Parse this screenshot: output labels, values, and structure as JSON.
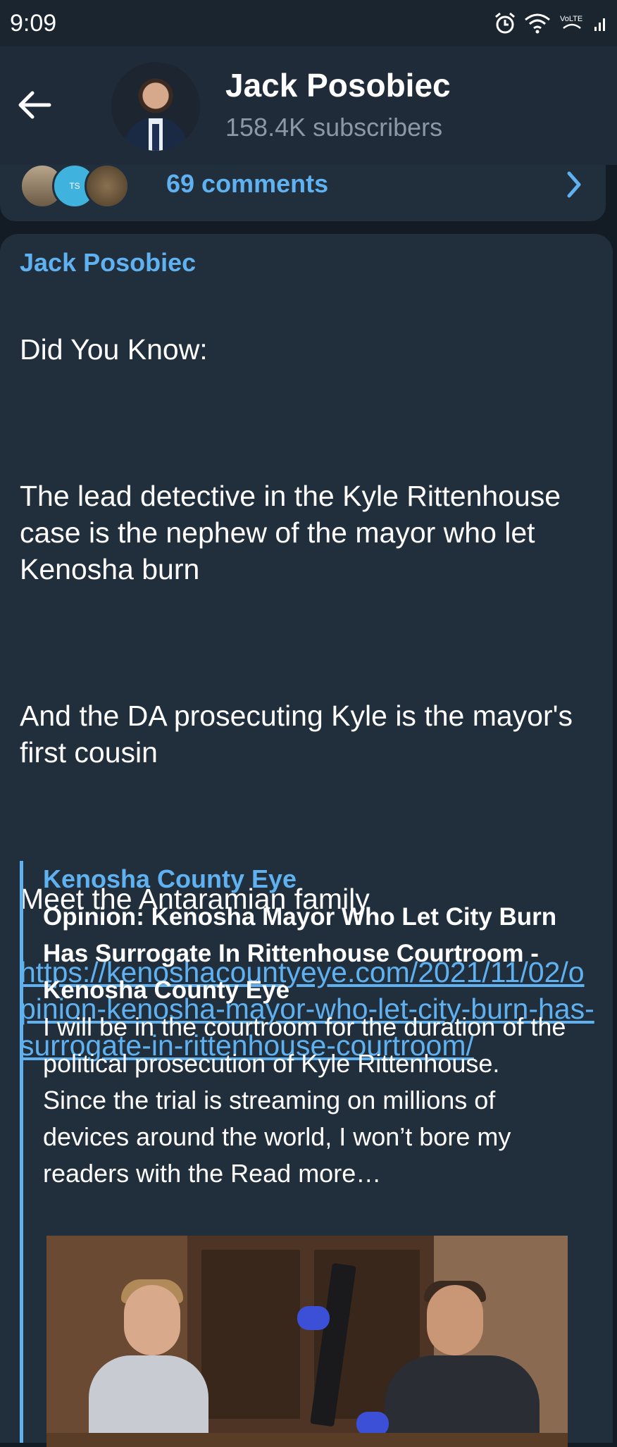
{
  "status_bar": {
    "time": "9:09",
    "icons": [
      "alarm-icon",
      "wifi-icon",
      "volte-icon",
      "signal-icon"
    ],
    "volte_label": "VoLTE"
  },
  "header": {
    "channel_name": "Jack Posobiec",
    "subscribers": "158.4K subscribers"
  },
  "previous_post": {
    "comments_label": "69 comments",
    "commenter_initials": "TS"
  },
  "message": {
    "author": "Jack Posobiec",
    "line1": "Did You Know:",
    "para2": "The lead detective in the Kyle Rittenhouse case is the nephew of the mayor who let Kenosha burn",
    "para3": "And the DA prosecuting Kyle is the mayor's first cousin",
    "para4": "Meet the Antaramian family",
    "link": "https://kenoshacountyeye.com/2021/11/02/opinion-kenosha-mayor-who-let-city-burn-has-surrogate-in-rittenhouse-courtroom/"
  },
  "link_preview": {
    "site_name": "Kenosha County Eye",
    "title": "Opinion: Kenosha Mayor Who Let City Burn Has Surrogate In Rittenhouse Courtroom - Kenosha County Eye",
    "description": "I will be in the courtroom for the duration of the political prosecution of Kyle Rittenhouse. Since the trial is streaming on millions of devices around the world, I won’t bore my readers with the Read more…"
  },
  "colors": {
    "accent": "#5fb1f0",
    "background": "#131b24",
    "card": "#212e3c",
    "header": "#1f2b38"
  }
}
